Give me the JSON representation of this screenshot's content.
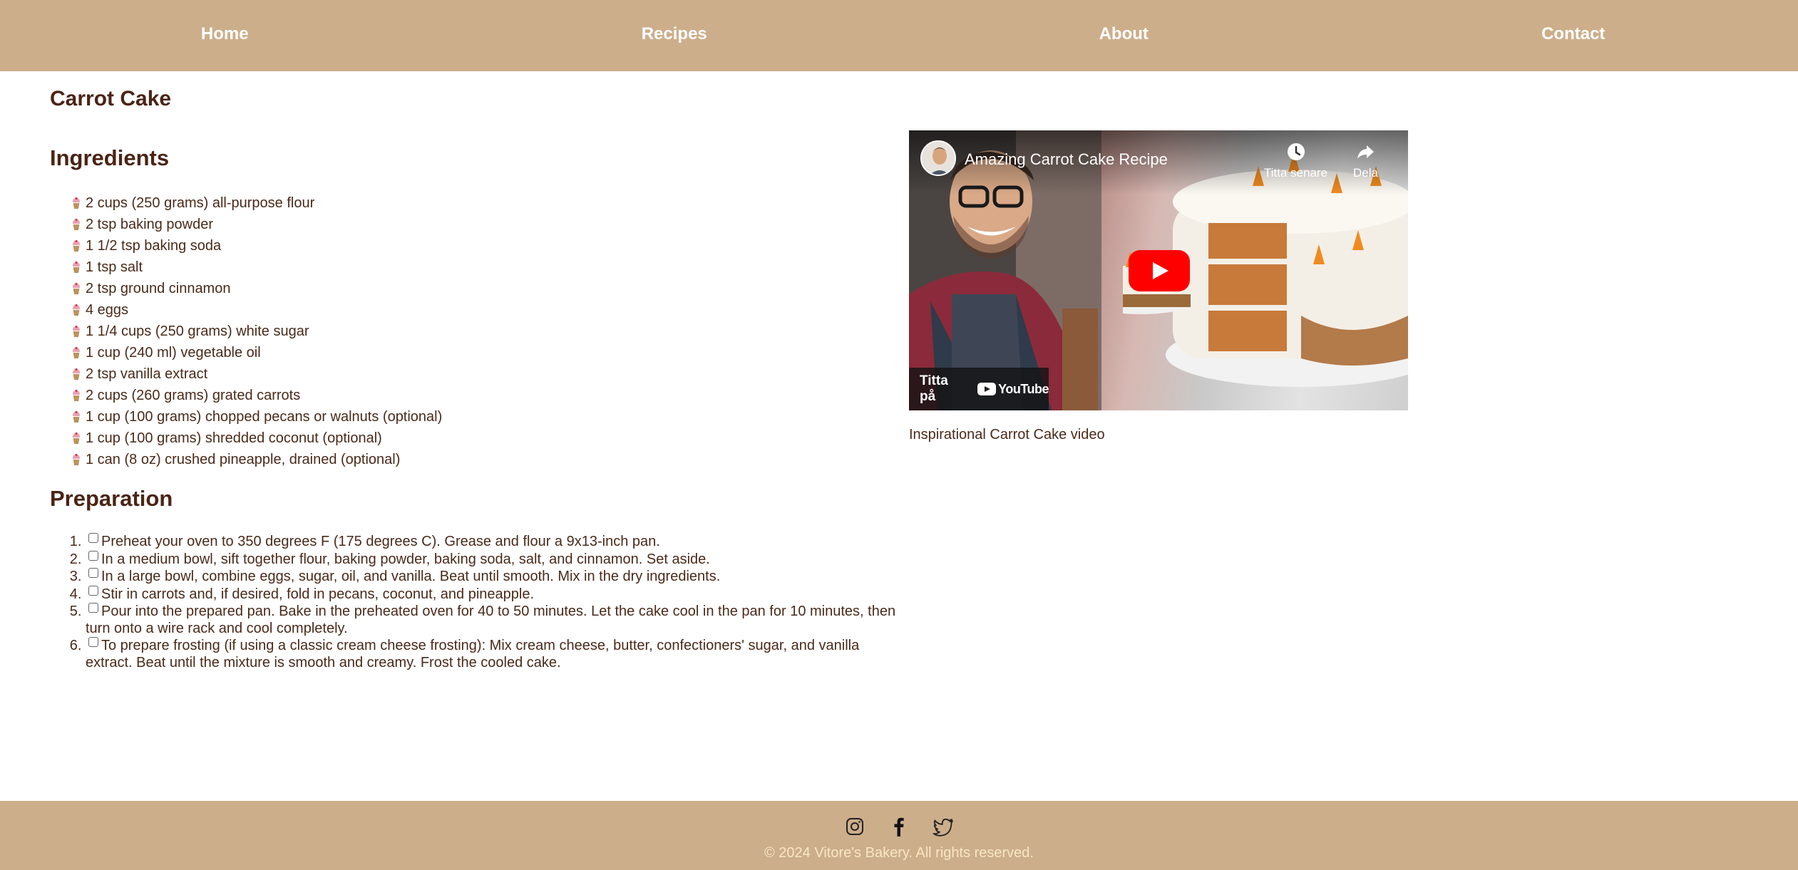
{
  "nav": {
    "items": [
      {
        "label": "Home"
      },
      {
        "label": "Recipes"
      },
      {
        "label": "About"
      },
      {
        "label": "Contact"
      }
    ]
  },
  "recipe": {
    "title": "Carrot Cake",
    "ingredients_heading": "Ingredients",
    "ingredients": [
      "2 cups (250 grams) all-purpose flour",
      "2 tsp baking powder",
      "1 1/2 tsp baking soda",
      "1 tsp salt",
      "2 tsp ground cinnamon",
      "4 eggs",
      "1 1/4 cups (250 grams) white sugar",
      "1 cup (240 ml) vegetable oil",
      "2 tsp vanilla extract",
      "2 cups (260 grams) grated carrots",
      "1 cup (100 grams) chopped pecans or walnuts (optional)",
      "1 cup (100 grams) shredded coconut (optional)",
      "1 can (8 oz) crushed pineapple, drained (optional)"
    ],
    "preparation_heading": "Preparation",
    "steps": [
      "Preheat your oven to 350 degrees F (175 degrees C). Grease and flour a 9x13-inch pan.",
      "In a medium bowl, sift together flour, baking powder, baking soda, salt, and cinnamon. Set aside.",
      "In a large bowl, combine eggs, sugar, oil, and vanilla. Beat until smooth. Mix in the dry ingredients.",
      "Stir in carrots and, if desired, fold in pecans, coconut, and pineapple.",
      "Pour into the prepared pan. Bake in the preheated oven for 40 to 50 minutes. Let the cake cool in the pan for 10 minutes, then turn onto a wire rack and cool completely.",
      "To prepare frosting (if using a classic cream cheese frosting): Mix cream cheese, butter, confectioners' sugar, and vanilla extract. Beat until the mixture is smooth and creamy. Frost the cooled cake."
    ]
  },
  "video": {
    "title": "Amazing Carrot Cake Recipe",
    "watch_later": "Titta senare",
    "share": "Dela",
    "watch_on": "Titta på",
    "youtube": "YouTube",
    "caption": "Inspirational Carrot Cake video"
  },
  "footer": {
    "social": [
      "instagram-icon",
      "facebook-icon",
      "twitter-icon"
    ],
    "copyright": "© 2024 Vitore's Bakery. All rights reserved."
  },
  "colors": {
    "nav_bg": "#cdae8a",
    "heading": "#4a2415",
    "footer_text": "#f7e6c4",
    "yt_red": "#ff0000"
  }
}
